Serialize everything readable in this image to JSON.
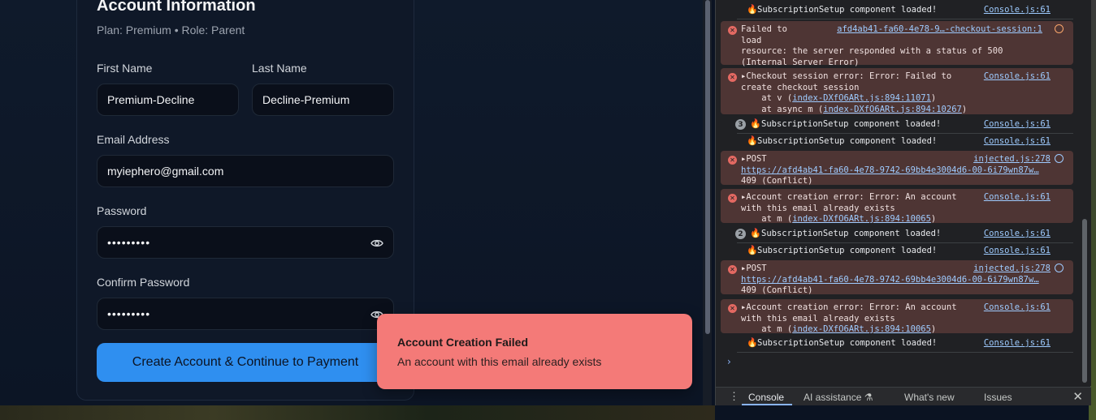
{
  "form": {
    "title": "Account Information",
    "subtitle": "Plan: Premium • Role: Parent",
    "first_name_label": "First Name",
    "first_name_value": "Premium-Decline",
    "last_name_label": "Last Name",
    "last_name_value": "Decline-Premium",
    "email_label": "Email Address",
    "email_value": "myiephero@gmail.com",
    "password_label": "Password",
    "password_value": "•••••••••",
    "confirm_label": "Confirm Password",
    "confirm_value": "•••••••••",
    "submit_label": "Create Account & Continue to Payment"
  },
  "toast": {
    "title": "Account Creation Failed",
    "message": "An account with this email already exists"
  },
  "devtools": {
    "messages": {
      "m1": {
        "text": "SubscriptionSetup component loaded!",
        "source": "Console.js:61"
      },
      "m2": {
        "line1": "Failed to",
        "line2": "load",
        "line3": "resource: the server responded with a status of 500",
        "line4": "(Internal Server Error)",
        "source": "afd4ab41-fa60-4e78-9…-checkout-session:1"
      },
      "m3": {
        "line1": "Checkout session error: Error: Failed to",
        "line2": "create checkout session",
        "line3a": "at v (",
        "line3link": "index-DXfO6ARt.js:894:11071",
        "line3b": ")",
        "line4a": "at async m (",
        "line4link": "index-DXfO6ARt.js:894:10267",
        "line4b": ")",
        "source": "Console.js:61"
      },
      "m4": {
        "count": "3",
        "text": "SubscriptionSetup component loaded!",
        "source": "Console.js:61"
      },
      "m5": {
        "text": "SubscriptionSetup component loaded!",
        "source": "Console.js:61"
      },
      "m6": {
        "line1": "POST",
        "line2": "https://afd4ab41-fa60-4e78-9742-69bb4e3004d6-00-6i79wn87w…",
        "line3": "409 (Conflict)",
        "source": "injected.js:278"
      },
      "m7": {
        "line1": "Account creation error: Error: An account",
        "line2": "with this email already exists",
        "line3a": "at m (",
        "line3link": "index-DXfO6ARt.js:894:10065",
        "line3b": ")",
        "source": "Console.js:61"
      },
      "m8": {
        "count": "2",
        "text": "SubscriptionSetup component loaded!",
        "source": "Console.js:61"
      },
      "m9": {
        "text": "SubscriptionSetup component loaded!",
        "source": "Console.js:61"
      },
      "m10": {
        "line1": "POST",
        "line2": "https://afd4ab41-fa60-4e78-9742-69bb4e3004d6-00-6i79wn87w…",
        "line3": "409 (Conflict)",
        "source": "injected.js:278"
      },
      "m11": {
        "line1": "Account creation error: Error: An account",
        "line2": "with this email already exists",
        "line3a": "at m (",
        "line3link": "index-DXfO6ARt.js:894:10065",
        "line3b": ")",
        "source": "Console.js:61"
      },
      "m12": {
        "text": "SubscriptionSetup component loaded!",
        "source": "Console.js:61"
      }
    },
    "prompt": "›",
    "tabs": {
      "console": "Console",
      "ai": "AI assistance",
      "whats_new": "What's new",
      "issues": "Issues"
    }
  },
  "colors": {
    "accent": "#2f8ff0",
    "toast_bg": "#f47a78",
    "error_row_bg": "#4e3534",
    "link": "#9ecbff"
  },
  "icons": [
    "eye-icon",
    "fire-icon",
    "error-icon",
    "globe-icon",
    "kebab-menu-icon",
    "close-icon",
    "flask-icon",
    "expand-triangle-icon"
  ]
}
